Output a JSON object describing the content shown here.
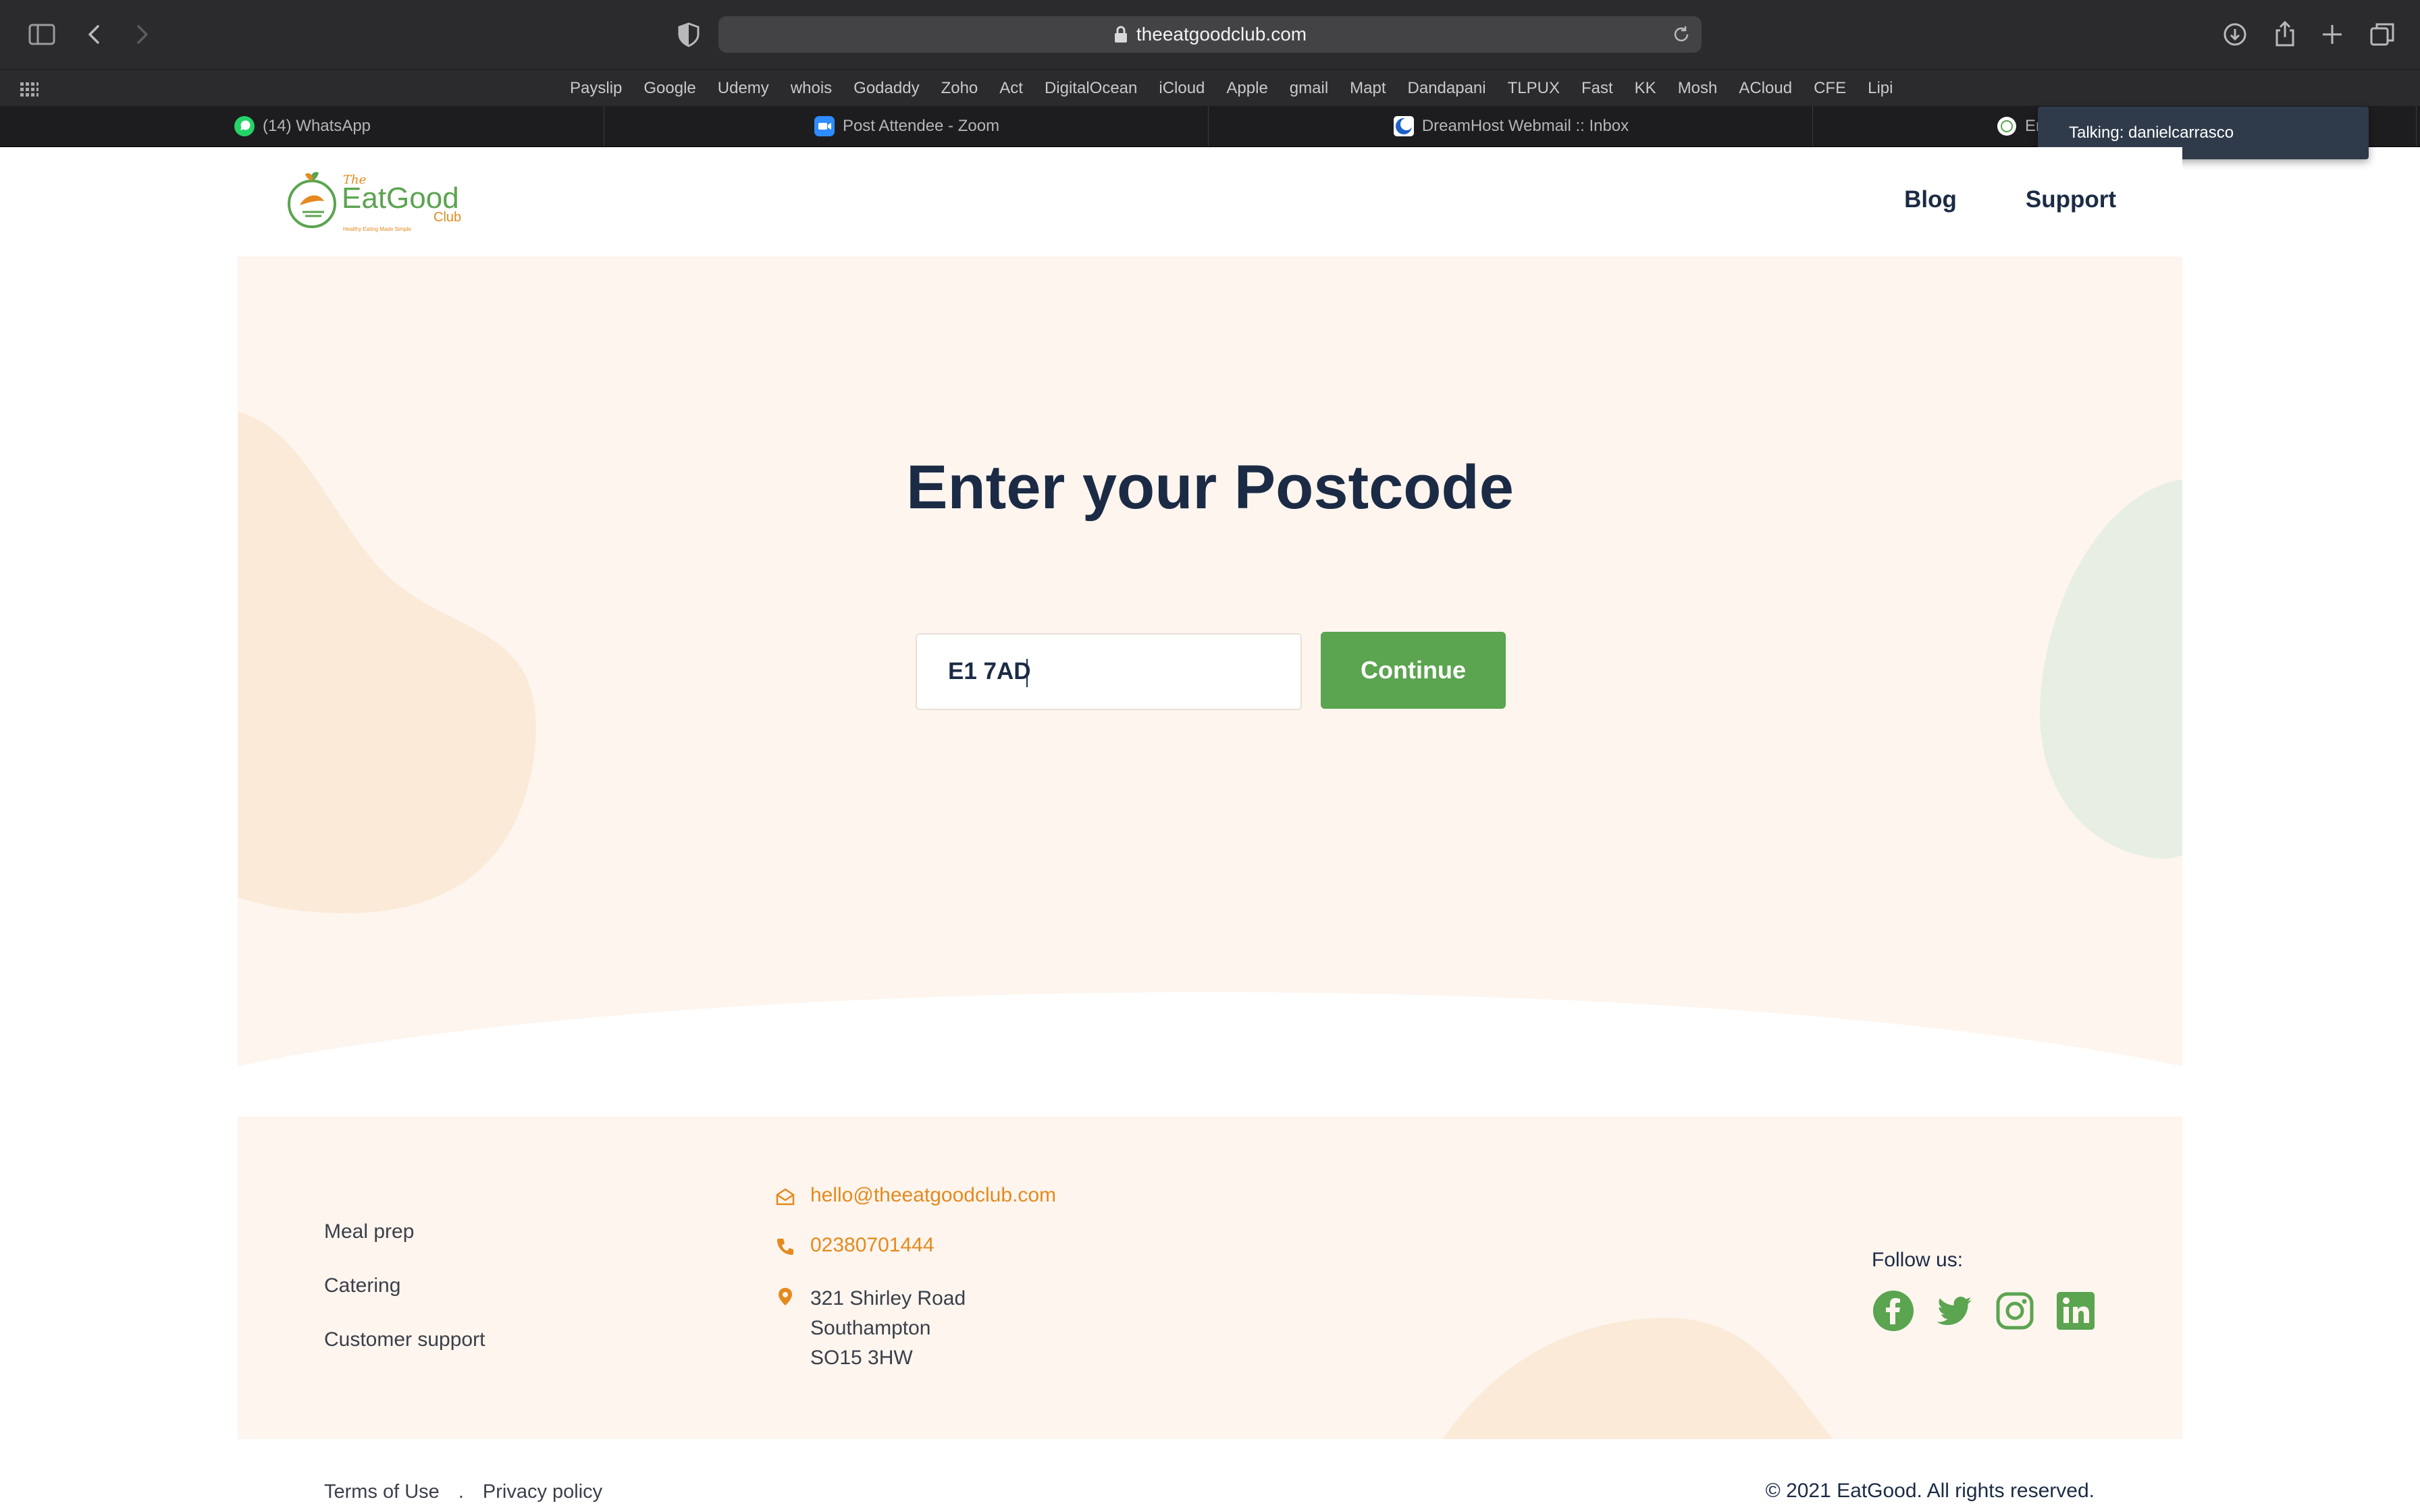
{
  "browser": {
    "url": "theeatgoodclub.com",
    "bookmarks": [
      "Payslip",
      "Google",
      "Udemy",
      "whois",
      "Godaddy",
      "Zoho",
      "Act",
      "DigitalOcean",
      "iCloud",
      "Apple",
      "gmail",
      "Mapt",
      "Dandapani",
      "TLPUX",
      "Fast",
      "KK",
      "Mosh",
      "ACloud",
      "CFE",
      "Lipi"
    ],
    "tabs": [
      {
        "label": "(14) WhatsApp",
        "icon": "whatsapp-icon",
        "color": "#25d366"
      },
      {
        "label": "Post Attendee - Zoom",
        "icon": "zoom-icon",
        "color": "#2d8cff"
      },
      {
        "label": "DreamHost Webmail :: Inbox",
        "icon": "dreamhost-icon",
        "color": "#1e60c9"
      },
      {
        "label": "Er",
        "icon": "eatgood-icon",
        "color": "#ffffff"
      }
    ],
    "tooltip": "Talking: danielcarrasco"
  },
  "header": {
    "logo_small": "The",
    "logo_main": "EatGood",
    "logo_sub": "Club",
    "logo_tagline": "Healthy Eating Made Simple",
    "nav": {
      "blog": "Blog",
      "support": "Support"
    }
  },
  "hero": {
    "title": "Enter your Postcode",
    "postcode_value": "E1 7AD",
    "continue_label": "Continue"
  },
  "footer": {
    "links": [
      "Meal prep",
      "Catering",
      "Customer support"
    ],
    "email": "hello@theeatgoodclub.com",
    "phone": "02380701444",
    "address": [
      "321 Shirley Road",
      "Southampton",
      "SO15 3HW"
    ],
    "follow_label": "Follow us:",
    "socials": [
      "facebook-icon",
      "twitter-icon",
      "instagram-icon",
      "linkedin-icon"
    ],
    "legal": {
      "terms": "Terms of Use",
      "separator": ".",
      "privacy": "Privacy policy"
    },
    "copyright": "© 2021 EatGood. All rights reserved."
  },
  "colors": {
    "brand_green": "#5ba450",
    "navy": "#1c2b45",
    "accent_orange": "#e48a1e",
    "cream": "#fdf5ee"
  }
}
